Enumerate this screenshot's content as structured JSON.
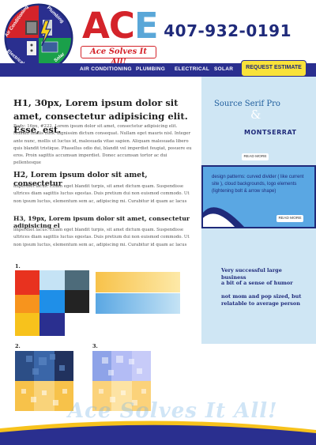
{
  "header": {
    "logo_words": [
      "Air Conditioning",
      "Plumbing",
      "Electrical",
      "Solar"
    ],
    "brand": "ACE",
    "tagline": "Ace Solves It All!",
    "phone": "407-932-0191"
  },
  "nav": {
    "items": [
      "AIR CONDITIONING",
      "PLUMBING",
      "ELECTRICAL",
      "SOLAR"
    ],
    "cta": "REQUEST ESTIMATE"
  },
  "main": {
    "h1": "H1, 30px, Lorem ipsum dolor sit amet, consectetur adipisicing elit. Esse, est.",
    "p1": "Body: 16px, #222, Lorem ipsum dolor sit amet, consectetur adipisicing elit. Nullam mollis nunc dignissim dictum consequat. Nullam eget mauris nisl. Integer ante nunc, mollis ut luctus id, malesuada vitae sapien. Aliquam malesuada libero quis blandit tristique. Phasellus odio dui, blandit vel imperdiet feugiat, posuere eu eros. Proin sagittis accumsan imperdiet. Donec accumsan tortor ac dui pellentesque",
    "h2": "H2, Lorem ipsum dolor sit amet, consectetur",
    "p2": "imperdiet lacus. Etiam eget blandit turpis, sit amet dictum quam. Suspendisse ultrices diam sagittis luctus egestas. Duis pretium dui non euismod commodo. Ut non ipsum luctus, elementum sem ac, adipiscing mi. Curabitur id quam ac lacus",
    "h3": "H3, 19px, Lorem ipsum dolor sit amet, consectetur adipisicing el",
    "p3": "imperdiet lacus. Etiam eget blandit turpis, sit amet dictum quam. Suspendisse ultrices diam sagittis luctus egestas. Duis pretium dui non euismod commodo. Ut non ipsum luctus, elementum sem ac, adipiscing mi. Curabitur id quam ac lacus"
  },
  "palette": {
    "label": "1.",
    "swatches": [
      "#e8321f",
      "#c5e3f5",
      "#4d6b7a",
      "#f7941d",
      "#1f8fe8",
      "#232323",
      "#f7c21c",
      "#2a2f8f"
    ],
    "gradients": [
      [
        "#f7c24a",
        "#fde9a8"
      ],
      [
        "#5aa7e3",
        "#c5e3f5"
      ]
    ]
  },
  "patterns": [
    {
      "label": "2.",
      "colors": [
        "#3a66a8",
        "#2c4e86",
        "#283f74",
        "#21325e",
        "#f7c24a",
        "#f9d37a"
      ]
    },
    {
      "label": "3.",
      "colors": [
        "#8ea3e8",
        "#9fb0f0",
        "#b3bcf5",
        "#c7cbf8",
        "#fbd27a",
        "#fde3a4"
      ]
    }
  ],
  "sidebar": {
    "font1": "Source Serif Pro",
    "amp": "&",
    "font2": "MONTSERRAT",
    "read_more": "READ MORE",
    "design_patterns": "design patterns: curved divider ( like current site ), cloud backgrounds, logo elements (lightening bolt & arrow shape)",
    "lines": [
      "Very successful large business",
      "a bit of a sense of humor",
      "not mom and pop sized, but relatable to average person"
    ]
  },
  "footer": {
    "tagline": "Ace Solves It All!"
  }
}
